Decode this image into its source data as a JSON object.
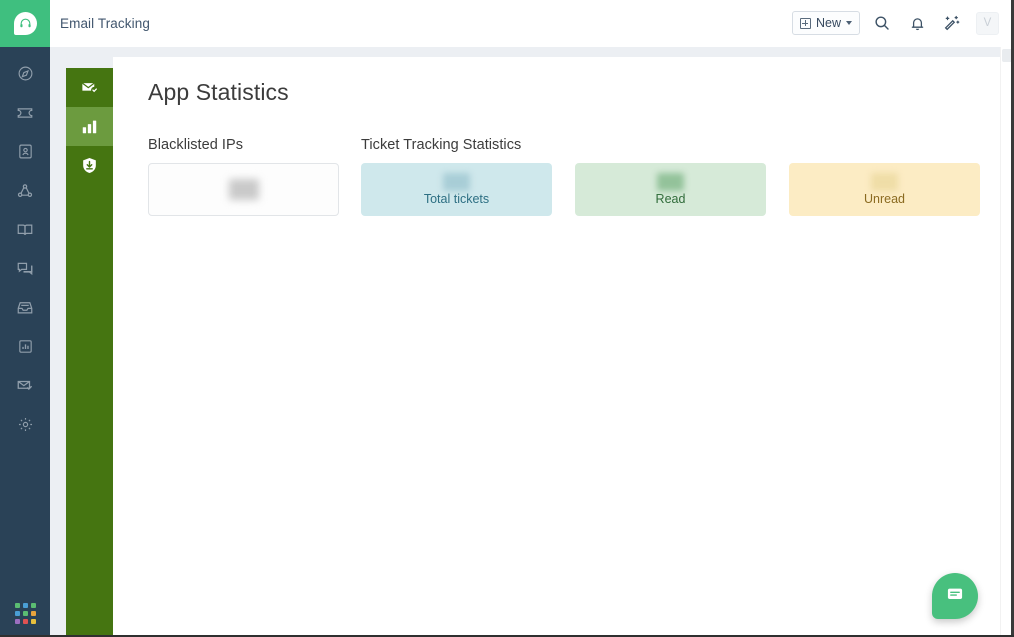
{
  "window": {
    "accent_green": "#3fbf7f",
    "rail_bg": "#2a4257",
    "module_green": "#457511",
    "module_green_active": "#6c9b3f"
  },
  "logo": {
    "icon": "headset-leaf-logo-icon",
    "alt": "Freshdesk logo"
  },
  "topbar": {
    "app_title": "Email Tracking",
    "new_button_label": "New",
    "new_button_icon": "plus-square-icon",
    "new_button_caret": "chevron-down-icon",
    "search_icon": "search-icon",
    "notifications_icon": "bell-icon",
    "assist_icon": "magic-wand-sparkle-icon",
    "avatar_initial": "V"
  },
  "rail": {
    "items": [
      {
        "icon": "compass-dashboard-icon",
        "label": "Dashboard"
      },
      {
        "icon": "ticket-icon",
        "label": "Tickets"
      },
      {
        "icon": "contact-card-icon",
        "label": "Contacts"
      },
      {
        "icon": "network-share-icon",
        "label": "Customers"
      },
      {
        "icon": "book-open-icon",
        "label": "Solutions"
      },
      {
        "icon": "chat-bubbles-icon",
        "label": "Forums"
      },
      {
        "icon": "inbox-tray-icon",
        "label": "Social"
      },
      {
        "icon": "bar-chart-box-icon",
        "label": "Analytics"
      },
      {
        "icon": "envelope-check-icon",
        "label": "Email"
      },
      {
        "icon": "gear-icon",
        "label": "Admin"
      }
    ],
    "app_grid_icon": "app-grid-icon",
    "app_grid_colors": [
      "#5bbd72",
      "#4a9fd5",
      "#5bbd72",
      "#4a9fd5",
      "#5bbd72",
      "#e8a33d",
      "#9b6fc0",
      "#e05252",
      "#e8c03d"
    ]
  },
  "module_rail": {
    "items": [
      {
        "icon": "envelope-check-icon",
        "label": "Email Tracking",
        "active": false
      },
      {
        "icon": "bar-chart-icon",
        "label": "App Statistics",
        "active": true
      },
      {
        "icon": "shield-download-icon",
        "label": "Blacklist",
        "active": false
      }
    ]
  },
  "main": {
    "page_title": "App Statistics",
    "sections": [
      {
        "label": "Blacklisted IPs",
        "cards": [
          {
            "style": "plain",
            "value": "",
            "label": ""
          }
        ]
      },
      {
        "label": "Ticket Tracking Statistics",
        "cards": [
          {
            "style": "blue",
            "value": "",
            "label": "Total tickets"
          },
          {
            "style": "green",
            "value": "",
            "label": "Read"
          },
          {
            "style": "yellow",
            "value": "",
            "label": "Unread"
          }
        ]
      }
    ]
  },
  "fab": {
    "icon": "chat-bubble-icon",
    "label": "Support chat",
    "color": "#48c07e"
  }
}
